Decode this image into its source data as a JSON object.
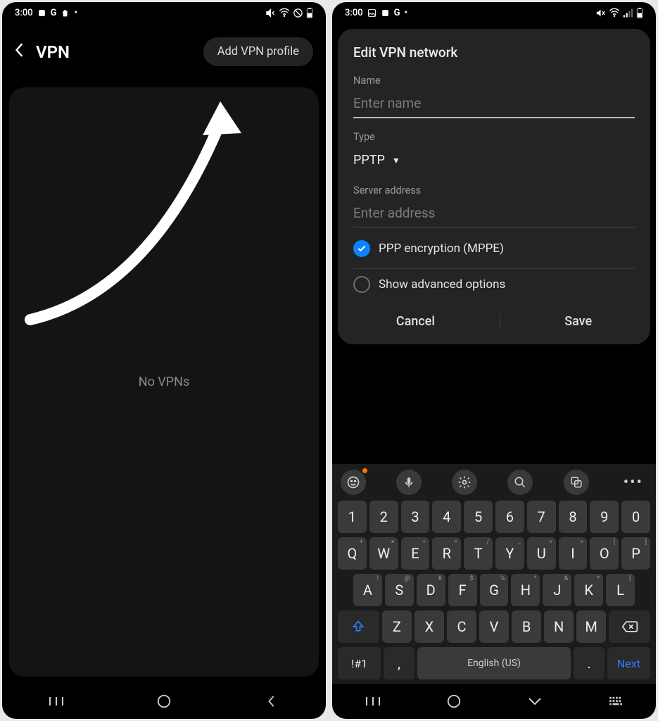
{
  "left": {
    "status": {
      "time": "3:00",
      "icons_left": [
        "dot",
        "G",
        "bag",
        "•"
      ],
      "icons_right": [
        "mute",
        "wifi",
        "no",
        "battery"
      ]
    },
    "header": {
      "title": "VPN",
      "add_btn": "Add VPN profile"
    },
    "empty_text": "No VPNs"
  },
  "right": {
    "status": {
      "time": "3:00",
      "icons_left": [
        "image",
        "dot",
        "G",
        "•"
      ],
      "icons_right": [
        "mute",
        "wifi",
        "signal",
        "battery"
      ]
    },
    "dialog": {
      "title": "Edit VPN network",
      "name_label": "Name",
      "name_placeholder": "Enter name",
      "type_label": "Type",
      "type_value": "PPTP",
      "server_label": "Server address",
      "server_placeholder": "Enter address",
      "ppp_label": "PPP encryption (MPPE)",
      "adv_label": "Show advanced options",
      "cancel": "Cancel",
      "save": "Save"
    },
    "keyboard": {
      "row_num": [
        "1",
        "2",
        "3",
        "4",
        "5",
        "6",
        "7",
        "8",
        "9",
        "0"
      ],
      "row_q": [
        "Q",
        "W",
        "E",
        "R",
        "T",
        "Y",
        "U",
        "I",
        "O",
        "P"
      ],
      "row_q_sup": [
        "+",
        "×",
        "÷",
        "=",
        "/",
        "_",
        "<",
        ">",
        "[",
        "]"
      ],
      "row_a": [
        "A",
        "S",
        "D",
        "F",
        "G",
        "H",
        "J",
        "K",
        "L"
      ],
      "row_a_sup": [
        "!",
        "@",
        "#",
        "$",
        "%",
        "^",
        "&",
        "*",
        "("
      ],
      "row_z": [
        "Z",
        "X",
        "C",
        "V",
        "B",
        "N",
        "M"
      ],
      "row_z_sup": [
        "",
        "",
        "",
        "",
        "",
        "",
        "",
        ""
      ],
      "sym": "!#1",
      "comma": ",",
      "space": "English (US)",
      "period": ".",
      "next": "Next"
    }
  }
}
